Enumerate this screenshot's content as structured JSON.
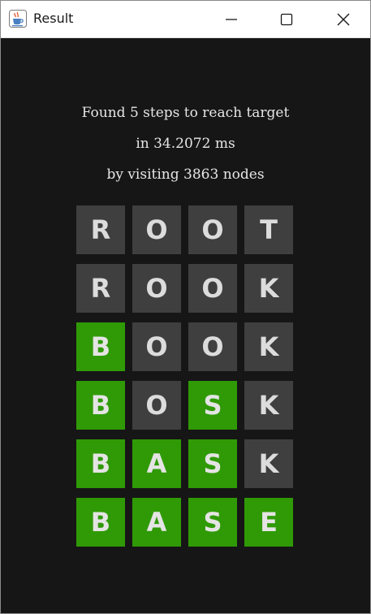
{
  "window": {
    "title": "Result",
    "icon": "java-cup-icon",
    "controls": [
      "minimize-icon",
      "maximize-icon",
      "close-icon"
    ]
  },
  "summary": {
    "line1": "Found 5 steps to reach target",
    "line2": "in 34.2072 ms",
    "line3": "by visiting 3863 nodes"
  },
  "colors": {
    "background": "#161616",
    "tile_default": "#3f3f3f",
    "tile_match": "#2f9a06",
    "tile_text": "#dcdcdc"
  },
  "board": [
    {
      "word": "ROOT",
      "letters": [
        {
          "ch": "R",
          "match": false
        },
        {
          "ch": "O",
          "match": false
        },
        {
          "ch": "O",
          "match": false
        },
        {
          "ch": "T",
          "match": false
        }
      ]
    },
    {
      "word": "ROOK",
      "letters": [
        {
          "ch": "R",
          "match": false
        },
        {
          "ch": "O",
          "match": false
        },
        {
          "ch": "O",
          "match": false
        },
        {
          "ch": "K",
          "match": false
        }
      ]
    },
    {
      "word": "BOOK",
      "letters": [
        {
          "ch": "B",
          "match": true
        },
        {
          "ch": "O",
          "match": false
        },
        {
          "ch": "O",
          "match": false
        },
        {
          "ch": "K",
          "match": false
        }
      ]
    },
    {
      "word": "BOSK",
      "letters": [
        {
          "ch": "B",
          "match": true
        },
        {
          "ch": "O",
          "match": false
        },
        {
          "ch": "S",
          "match": true
        },
        {
          "ch": "K",
          "match": false
        }
      ]
    },
    {
      "word": "BASK",
      "letters": [
        {
          "ch": "B",
          "match": true
        },
        {
          "ch": "A",
          "match": true
        },
        {
          "ch": "S",
          "match": true
        },
        {
          "ch": "K",
          "match": false
        }
      ]
    },
    {
      "word": "BASE",
      "letters": [
        {
          "ch": "B",
          "match": true
        },
        {
          "ch": "A",
          "match": true
        },
        {
          "ch": "S",
          "match": true
        },
        {
          "ch": "E",
          "match": true
        }
      ]
    }
  ]
}
